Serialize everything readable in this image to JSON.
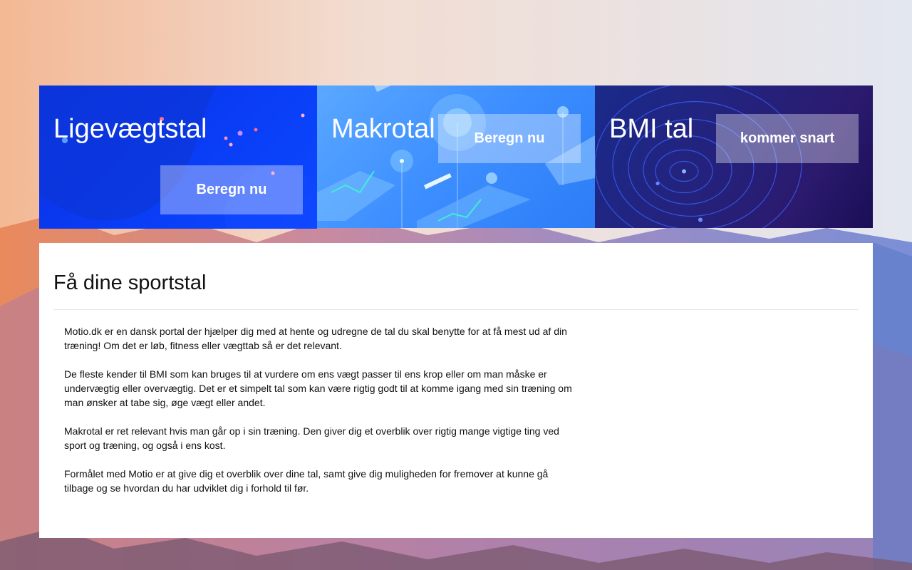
{
  "cards": [
    {
      "title": "Ligevægtstal",
      "button": "Beregn nu"
    },
    {
      "title": "Makrotal",
      "button": "Beregn nu"
    },
    {
      "title": "BMI tal",
      "button": "kommer snart"
    }
  ],
  "content": {
    "heading": "Få dine sportstal",
    "paragraphs": [
      "Motio.dk er en dansk portal der hjælper dig med at hente og udregne de tal du skal benytte for at få mest ud af din træning! Om det er løb, fitness eller vægttab så er det relevant.",
      "De fleste kender til BMI som kan bruges til at vurdere om ens vægt passer til ens krop eller om man måske er undervægtig eller overvægtig. Det er et simpelt tal som kan være rigtig godt til at komme igang med sin træning om man ønsker at tabe sig, øge vægt eller andet.",
      "Makrotal er ret relevant hvis man går op i sin træning. Den giver dig et overblik over rigtig mange vigtige ting ved sport og træning, og også i ens kost.",
      "Formålet med Motio er at give dig et overblik over dine tal, samt give dig muligheden for fremover at kunne gå tilbage og se hvordan du har udviklet dig i forhold til før."
    ]
  },
  "colors": {
    "card1": "#0a3cf5",
    "card2": "#3d8eff",
    "card3": "#24227c"
  }
}
